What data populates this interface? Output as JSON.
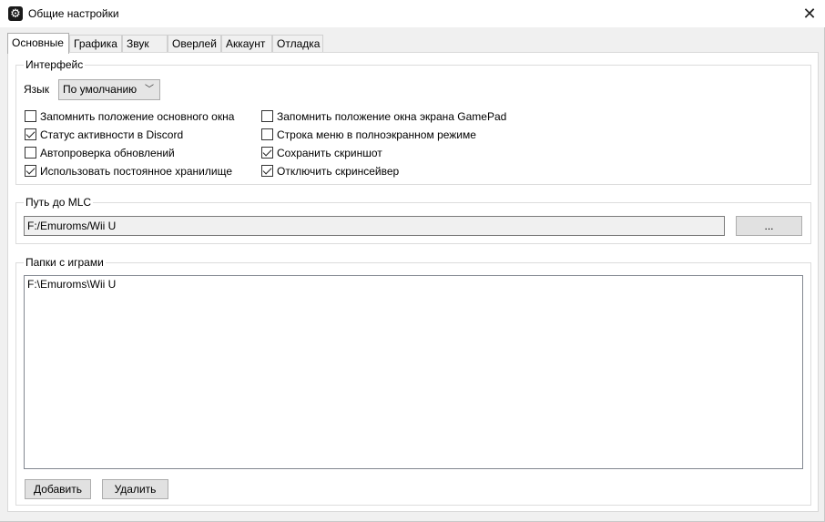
{
  "window": {
    "title": "Общие настройки",
    "close_glyph": "✕",
    "icon": "gear-icon"
  },
  "tabs": [
    {
      "label": "Основные",
      "active": true
    },
    {
      "label": "Графика",
      "active": false
    },
    {
      "label": "Звук",
      "active": false
    },
    {
      "label": "Оверлей",
      "active": false
    },
    {
      "label": "Аккаунт",
      "active": false
    },
    {
      "label": "Отладка",
      "active": false
    }
  ],
  "interface": {
    "legend": "Интерфейс",
    "language_label": "Язык",
    "language_value": "По умолчанию",
    "checkboxes_left": [
      {
        "label": "Запомнить положение основного окна",
        "checked": false
      },
      {
        "label": "Статус активности в Discord",
        "checked": true
      },
      {
        "label": "Автопроверка обновлений",
        "checked": false
      },
      {
        "label": "Использовать постоянное хранилище",
        "checked": true
      }
    ],
    "checkboxes_right": [
      {
        "label": "Запомнить положение окна экрана GamePad",
        "checked": false
      },
      {
        "label": "Строка меню в полноэкранном режиме",
        "checked": false
      },
      {
        "label": "Сохранить скриншот",
        "checked": true
      },
      {
        "label": "Отключить скринсейвер",
        "checked": true
      }
    ]
  },
  "mlc": {
    "legend": "Путь до MLC",
    "path": "F:/Emuroms/Wii U",
    "browse_label": "..."
  },
  "game_folders": {
    "legend": "Папки с играми",
    "items": [
      "F:\\Emuroms\\Wii U"
    ],
    "add_label": "Добавить",
    "remove_label": "Удалить"
  }
}
